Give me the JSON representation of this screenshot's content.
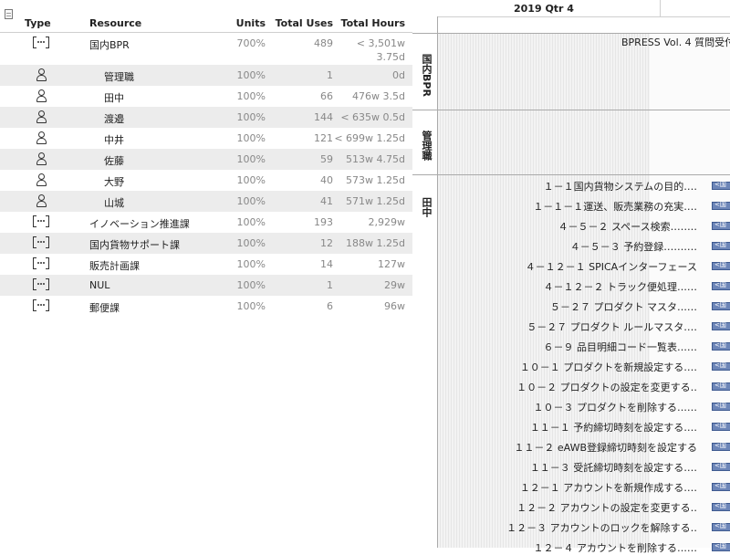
{
  "table": {
    "headers": {
      "type": "Type",
      "resource": "Resource",
      "units": "Units",
      "total_uses": "Total Uses",
      "total_hours": "Total Hours"
    },
    "rows": [
      {
        "kind": "group",
        "name": "国内BPR",
        "units": "700%",
        "uses": "489",
        "hours": "< 3,501w",
        "hours2": "3.75d",
        "indent": false
      },
      {
        "kind": "person",
        "name": "管理職",
        "units": "100%",
        "uses": "1",
        "hours": "0d",
        "hours2": "",
        "indent": true
      },
      {
        "kind": "person",
        "name": "田中",
        "units": "100%",
        "uses": "66",
        "hours": "476w 3.5d",
        "hours2": "",
        "indent": true
      },
      {
        "kind": "person",
        "name": "渡邉",
        "units": "100%",
        "uses": "144",
        "hours": "< 635w 0.5d",
        "hours2": "",
        "indent": true
      },
      {
        "kind": "person",
        "name": "中井",
        "units": "100%",
        "uses": "121",
        "hours": "< 699w 1.25d",
        "hours2": "",
        "indent": true
      },
      {
        "kind": "person",
        "name": "佐藤",
        "units": "100%",
        "uses": "59",
        "hours": "513w 4.75d",
        "hours2": "",
        "indent": true
      },
      {
        "kind": "person",
        "name": "大野",
        "units": "100%",
        "uses": "40",
        "hours": "573w 1.25d",
        "hours2": "",
        "indent": true
      },
      {
        "kind": "person",
        "name": "山城",
        "units": "100%",
        "uses": "41",
        "hours": "571w 1.25d",
        "hours2": "",
        "indent": true
      },
      {
        "kind": "group",
        "name": "イノベーション推進課",
        "units": "100%",
        "uses": "193",
        "hours": "2,929w",
        "hours2": "",
        "indent": false
      },
      {
        "kind": "group",
        "name": "国内貨物サポート課",
        "units": "100%",
        "uses": "12",
        "hours": "188w 1.25d",
        "hours2": "",
        "indent": false
      },
      {
        "kind": "group",
        "name": "販売計画課",
        "units": "100%",
        "uses": "14",
        "hours": "127w",
        "hours2": "",
        "indent": false
      },
      {
        "kind": "group",
        "name": "NUL",
        "units": "100%",
        "uses": "1",
        "hours": "29w",
        "hours2": "",
        "indent": false
      },
      {
        "kind": "group",
        "name": "郵便課",
        "units": "100%",
        "uses": "6",
        "hours": "96w",
        "hours2": "",
        "indent": false
      }
    ]
  },
  "gantt": {
    "quarter_label": "2019 Qtr 4",
    "bands": [
      {
        "label": "国内BPR"
      },
      {
        "label": "管理職"
      },
      {
        "label": "田中"
      }
    ],
    "top_task": "BPRESS Vol. 4 質問受付",
    "tasks": [
      "１－１国内貨物システムの目的‥‥",
      "１－１－１運送、販売業務の充実‥‥",
      "４－５－２ スペース検索‥‥‥‥",
      "４－５－３ 予約登録‥‥‥‥‥",
      "４－１２－１ SPICAインターフェース",
      "４－１２－２ トラック便処理‥‥‥",
      "５－２７ プロダクト マスタ‥‥‥",
      "５－２７ プロダクト ルールマスタ‥‥",
      "６－９ 品目明細コード一覧表‥‥‥",
      "１０－１ プロダクトを新規設定する‥‥",
      "１０－２ プロダクトの設定を変更する‥",
      "１０－３ プロダクトを削除する‥‥‥",
      "１１－１ 予約締切時刻を設定する‥‥",
      "１１－２ eAWB登録締切時刻を設定する",
      "１１－３ 受託締切時刻を設定する‥‥",
      "１２－１ アカウントを新規作成する‥‥",
      "１２－２ アカウントの設定を変更する‥",
      "１２－３ アカウントのロックを解除する‥",
      "１２－４ アカウントを削除する‥‥‥"
    ],
    "bar_color": "#6d86b8"
  }
}
